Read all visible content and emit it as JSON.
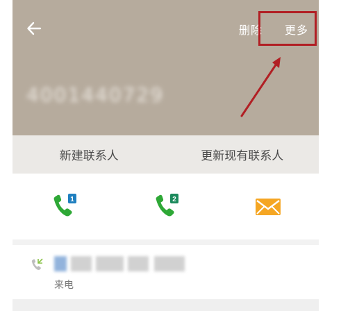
{
  "header": {
    "back_icon": "arrow-left-icon",
    "delete_label": "删除",
    "more_label": "更多",
    "phone_number": "4001440729",
    "background_color": "#b6ab9d",
    "annotation_color": "#b11f24"
  },
  "contact_actions": {
    "new_contact": "新建联系人",
    "update_contact": "更新现有联系人"
  },
  "comm_actions": {
    "call_sim1": {
      "icon": "phone-sim1-icon",
      "badge": "1",
      "color": "#2ea836"
    },
    "call_sim2": {
      "icon": "phone-sim2-icon",
      "badge": "2",
      "color": "#2ea836"
    },
    "message": {
      "icon": "envelope-icon",
      "color": "#f5a623"
    }
  },
  "call_log": [
    {
      "type_label": "来电",
      "icon": "incoming-call-icon"
    }
  ]
}
